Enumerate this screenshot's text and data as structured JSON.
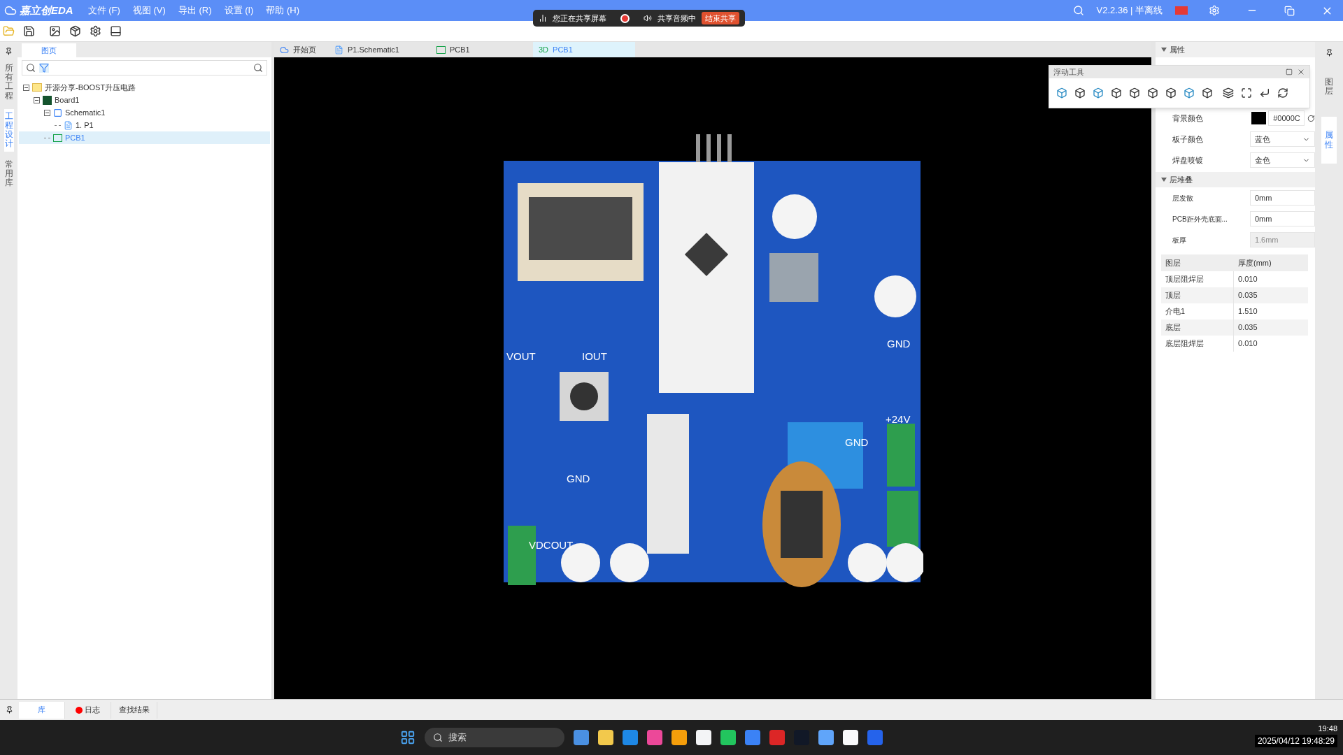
{
  "app": {
    "logo": "嘉立创EDA",
    "menu": [
      "文件 (F)",
      "视图 (V)",
      "导出 (R)",
      "设置 (I)",
      "帮助 (H)"
    ],
    "version": "V2.2.36 | 半离线"
  },
  "share_bar": {
    "status": "您正在共享屏幕",
    "audio": "共享音频中",
    "stop": "结束共享"
  },
  "side_tabs": [
    {
      "label": "所有工程",
      "selected": false
    },
    {
      "label": "工程设计",
      "selected": true
    },
    {
      "label": "常用库",
      "selected": false
    }
  ],
  "panel": {
    "tab": "图页",
    "tree": [
      {
        "label": "开源分享-BOOST升压电路",
        "kind": "folder",
        "selected": false,
        "expanded": true,
        "children": [
          {
            "label": "Board1",
            "kind": "board",
            "selected": false,
            "expanded": true,
            "children": [
              {
                "label": "Schematic1",
                "kind": "schematic",
                "selected": false,
                "expanded": true,
                "children": [
                  {
                    "label": "1. P1",
                    "kind": "page",
                    "selected": false
                  }
                ]
              },
              {
                "label": "PCB1",
                "kind": "pcb",
                "selected": true
              }
            ]
          }
        ]
      }
    ]
  },
  "doc_tabs": [
    {
      "label": "开始页",
      "kind": "home",
      "selected": false
    },
    {
      "label": "P1.Schematic1",
      "kind": "schematic",
      "selected": false
    },
    {
      "label": "PCB1",
      "kind": "pcb",
      "selected": false
    },
    {
      "label": "PCB1",
      "kind": "viewer",
      "prefix": "3D",
      "selected": true
    }
  ],
  "board_labels": [
    "VOUT",
    "IOUT",
    "GND",
    "+24V",
    "GND",
    "GND",
    "VDCOUT"
  ],
  "floating_tool": {
    "title": "浮动工具"
  },
  "properties": {
    "title": "属性",
    "rows": [
      {
        "label": "背景颜色",
        "kind": "color",
        "value": "#0000C"
      },
      {
        "label": "板子颜色",
        "kind": "select",
        "value": "蓝色"
      },
      {
        "label": "焊盘喷镀",
        "kind": "select",
        "value": "金色"
      }
    ],
    "stack_title": "层堆叠",
    "stack_rows": [
      {
        "label": "层发散",
        "kind": "input",
        "value": "0mm",
        "disabled": false
      },
      {
        "label": "PCB距外壳底面...",
        "kind": "input",
        "value": "0mm",
        "disabled": false
      },
      {
        "label": "板厚",
        "kind": "input",
        "value": "1.6mm",
        "disabled": true
      }
    ],
    "table": {
      "columns": [
        "图层",
        "厚度(mm)"
      ],
      "rows": [
        [
          "顶层阻焊层",
          "0.010"
        ],
        [
          "顶层",
          "0.035"
        ],
        [
          "介电1",
          "1.510"
        ],
        [
          "底层",
          "0.035"
        ],
        [
          "底层阻焊层",
          "0.010"
        ]
      ]
    }
  },
  "right_tabs": [
    {
      "label": "图层",
      "selected": false
    },
    {
      "label": "属性",
      "selected": true
    }
  ],
  "bottom_tabs": [
    {
      "label": "库",
      "kind": "plain",
      "selected": true
    },
    {
      "label": "日志",
      "kind": "alert",
      "selected": false
    },
    {
      "label": "查找结果",
      "kind": "plain",
      "selected": false
    }
  ],
  "taskbar": {
    "search": "搜索",
    "time": "19:48",
    "datetime": "2025/04/12 19:48:29"
  }
}
